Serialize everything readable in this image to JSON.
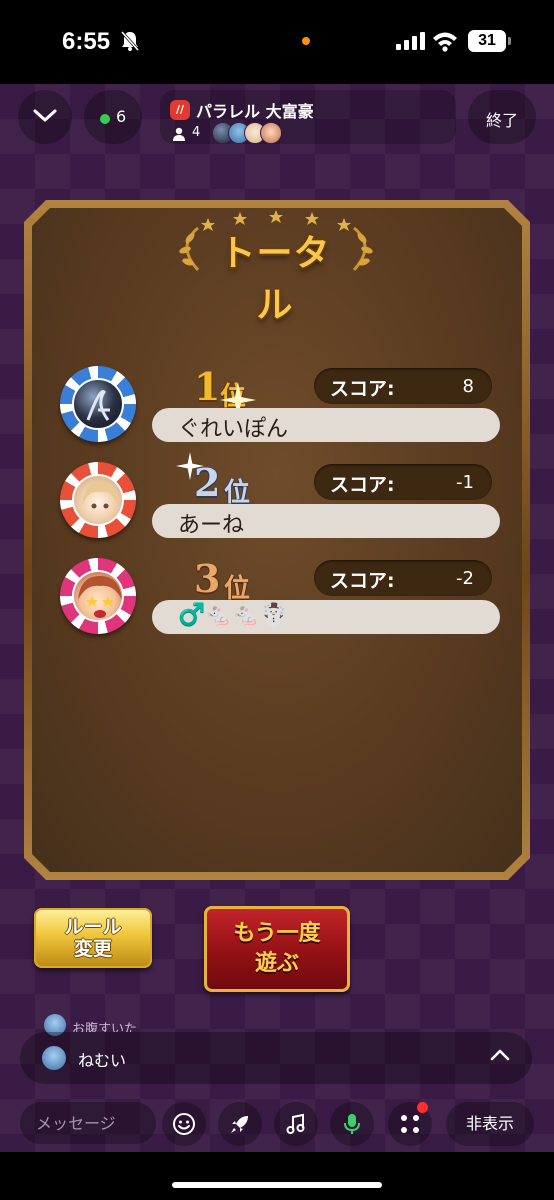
{
  "status_bar": {
    "time": "6:55",
    "battery": "31"
  },
  "header": {
    "online_count": "6",
    "room_logo": "//",
    "room_name": "パラレル 大富豪",
    "member_count": "4",
    "end_label": "終了"
  },
  "board": {
    "title": "トータル",
    "score_label": "スコア:",
    "rankings": [
      {
        "rank": "1",
        "suffix": "位",
        "name": "ぐれいぽん",
        "score": "8"
      },
      {
        "rank": "2",
        "suffix": "位",
        "name": "あーね",
        "score": "-1"
      },
      {
        "rank": "3",
        "suffix": "位",
        "name": "♂️🐁🐁☃️",
        "score": "-2"
      }
    ]
  },
  "buttons": {
    "rule_line1": "ルール",
    "rule_line2": "変更",
    "again_line1": "もう一度",
    "again_line2": "遊ぶ"
  },
  "chat": {
    "prev_message": "お腹すいた",
    "last_message": "ねむい"
  },
  "bottom_bar": {
    "message_placeholder": "メッセージ",
    "hide_label": "非表示"
  },
  "colors": {
    "background": "#3a1b45",
    "gold": "#f2b92d",
    "again_red": "#8e0f13",
    "chip_blue": "#3a7ed8",
    "chip_red": "#e8503a",
    "chip_pink": "#e0357a"
  },
  "icons": [
    "bell-slash-icon",
    "signal-icon",
    "wifi-icon",
    "chevron-down-icon",
    "person-icon",
    "chevron-up-icon",
    "emoji-icon",
    "rocket-icon",
    "music-icon",
    "mic-icon",
    "grid-icon"
  ]
}
